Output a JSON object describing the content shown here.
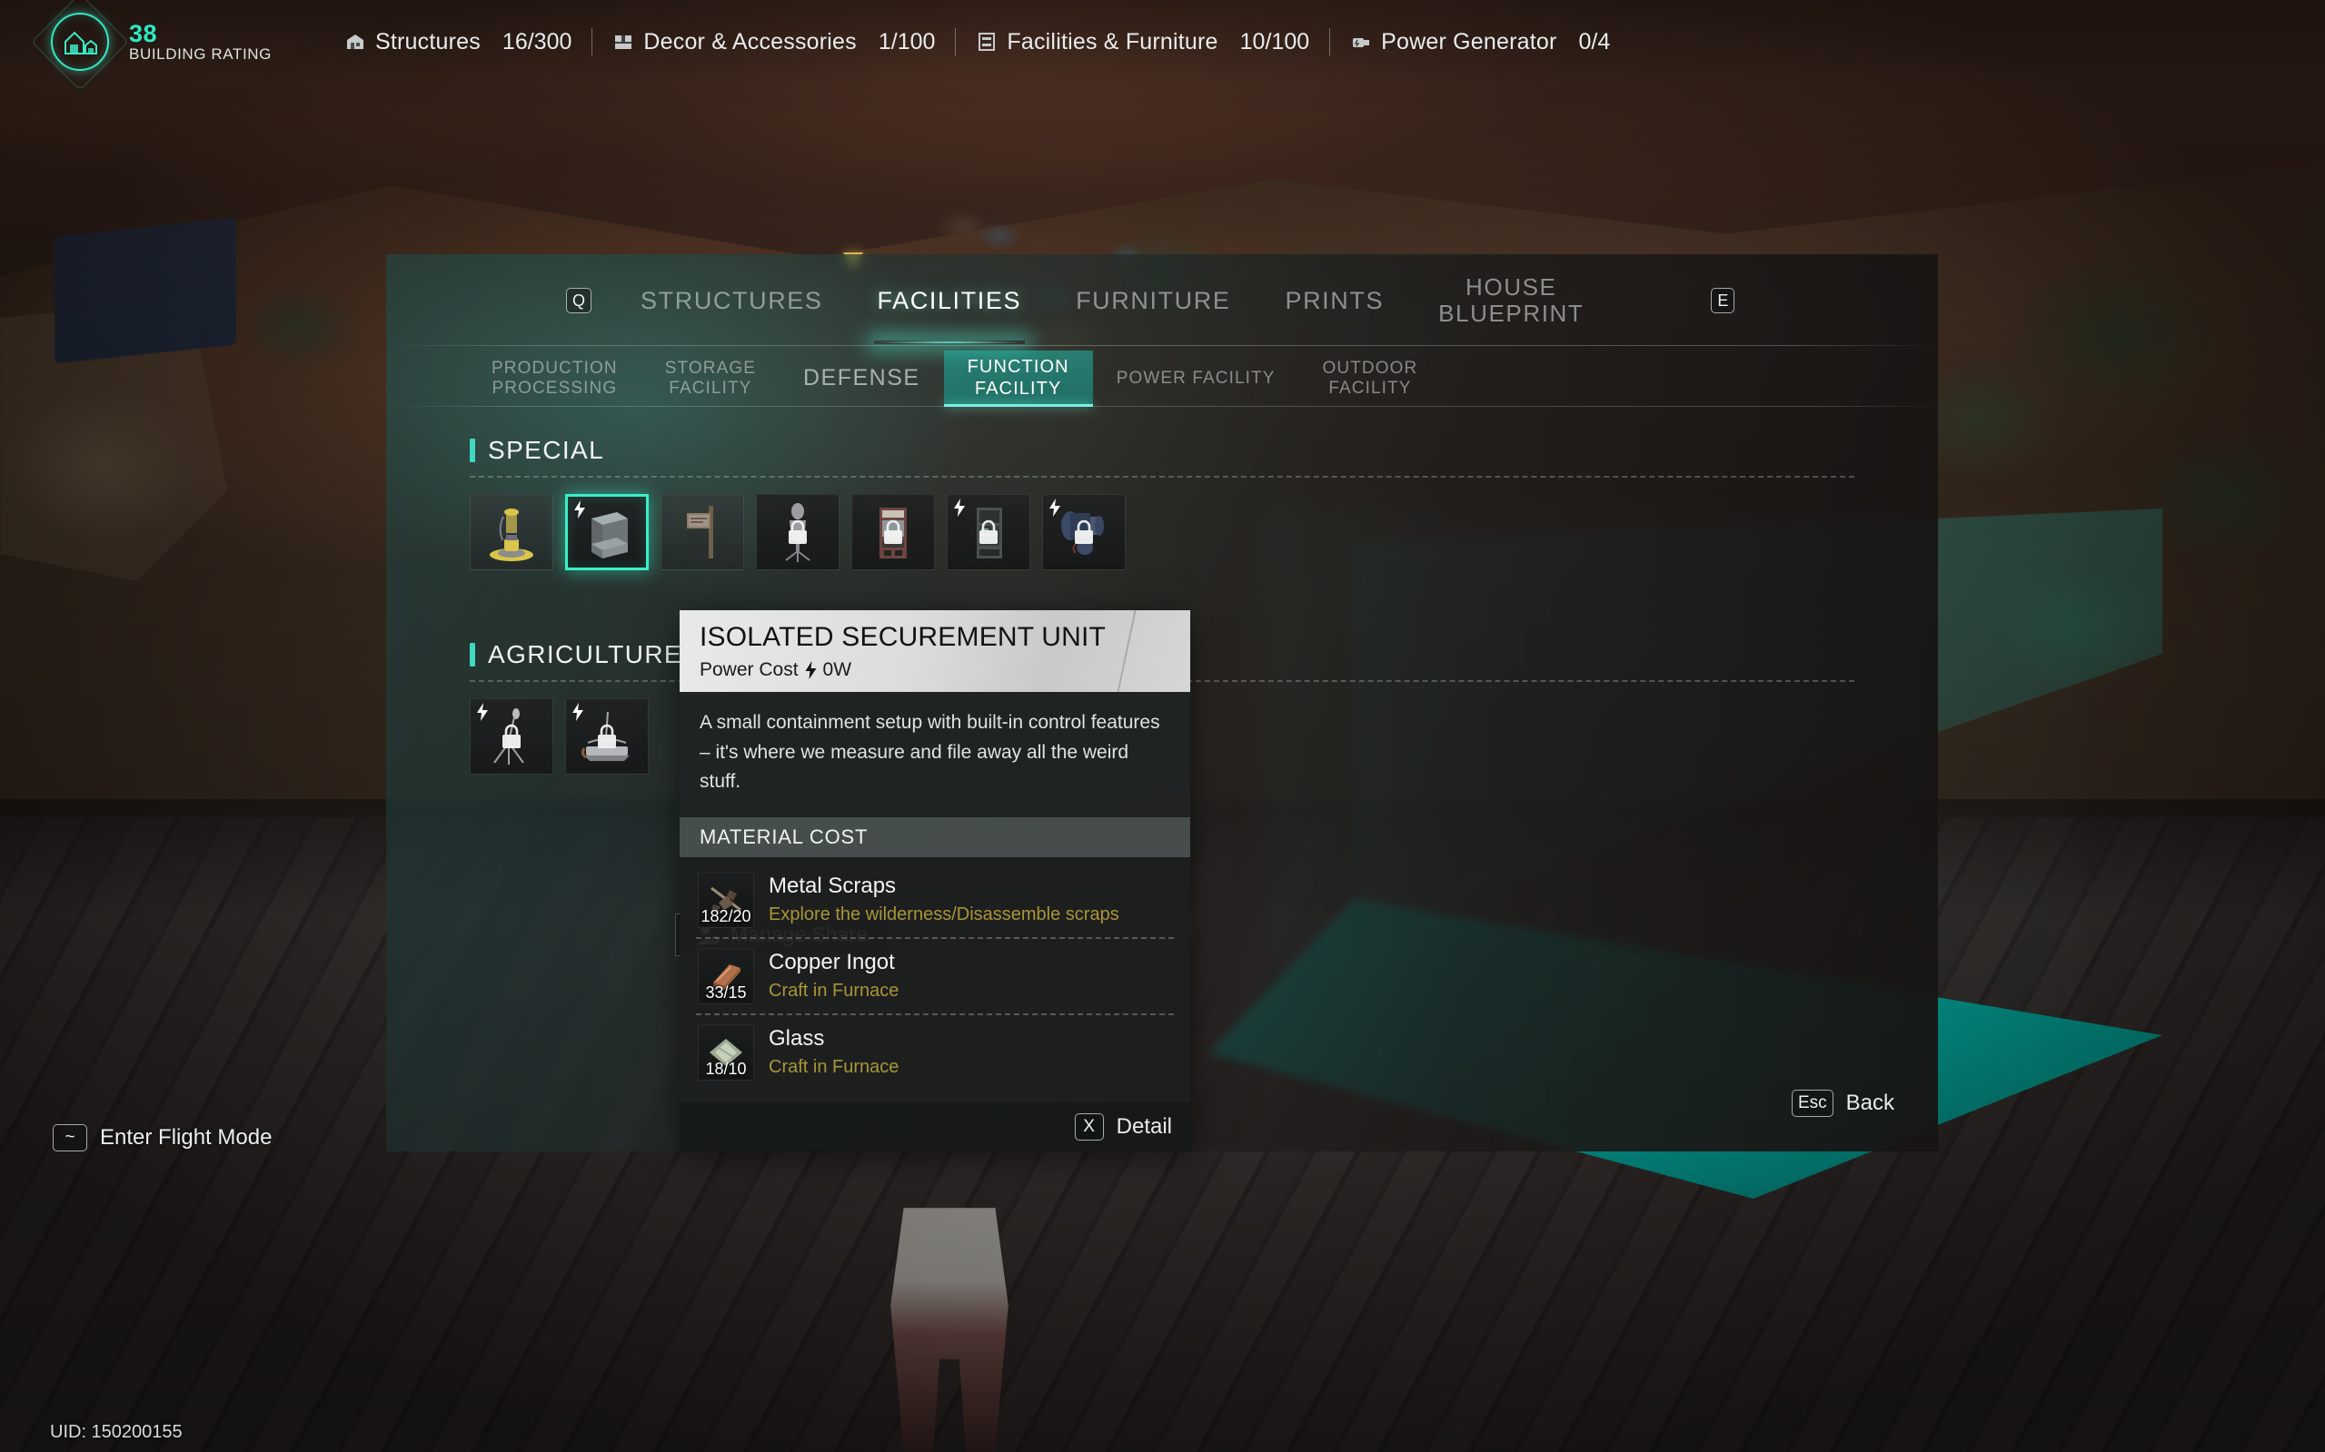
{
  "hud": {
    "rating_value": "38",
    "rating_label": "BUILDING RATING",
    "stats": [
      {
        "icon": "structures-icon",
        "name": "Structures",
        "value": "16/300"
      },
      {
        "icon": "decor-icon",
        "name": "Decor & Accessories",
        "value": "1/100"
      },
      {
        "icon": "facilities-icon",
        "name": "Facilities & Furniture",
        "value": "10/100"
      },
      {
        "icon": "power-generator-icon",
        "name": "Power Generator",
        "value": "0/4"
      }
    ]
  },
  "panel": {
    "left_key": "Q",
    "right_key": "E",
    "tabs": [
      {
        "label": "STRUCTURES",
        "active": false
      },
      {
        "label": "FACILITIES",
        "active": true
      },
      {
        "label": "FURNITURE",
        "active": false
      },
      {
        "label": "PRINTS",
        "active": false
      },
      {
        "label": "HOUSE\nBLUEPRINT",
        "active": false
      }
    ],
    "subtabs": [
      {
        "label": "PRODUCTION\nPROCESSING",
        "active": false
      },
      {
        "label": "STORAGE\nFACILITY",
        "active": false
      },
      {
        "label": "DEFENSE",
        "active": false
      },
      {
        "label": "FUNCTION\nFACILITY",
        "active": true
      },
      {
        "label": "POWER FACILITY",
        "active": false
      },
      {
        "label": "OUTDOOR\nFACILITY",
        "active": false
      }
    ],
    "groups": [
      {
        "title": "SPECIAL",
        "items": [
          {
            "name": "beacon-lamp",
            "selected": false,
            "locked": false,
            "powered": false
          },
          {
            "name": "isolated-securement-unit",
            "selected": true,
            "locked": false,
            "powered": true
          },
          {
            "name": "wall-sign",
            "selected": false,
            "locked": false,
            "powered": false
          },
          {
            "name": "mannequin-stand",
            "selected": false,
            "locked": true,
            "powered": false
          },
          {
            "name": "arcade-cabinet",
            "selected": false,
            "locked": true,
            "powered": false
          },
          {
            "name": "server-rack",
            "selected": false,
            "locked": true,
            "powered": true
          },
          {
            "name": "industrial-motor",
            "selected": false,
            "locked": true,
            "powered": true
          }
        ]
      },
      {
        "title": "AGRICULTURE",
        "items": [
          {
            "name": "sprinkler-tripod",
            "selected": false,
            "locked": true,
            "powered": true
          },
          {
            "name": "grow-bed",
            "selected": false,
            "locked": true,
            "powered": true
          }
        ]
      }
    ],
    "manage_share_label": "Manage Share",
    "back_key": "Esc",
    "back_label": "Back"
  },
  "tooltip": {
    "title": "ISOLATED SECUREMENT UNIT",
    "power_label": "Power Cost",
    "power_value": "0W",
    "description": "A small containment setup with built-in control features – it's where we measure and file away all the weird stuff.",
    "material_cost_label": "MATERIAL COST",
    "materials": [
      {
        "name": "Metal Scraps",
        "source": "Explore the wilderness/Disassemble scraps",
        "count": "182/20",
        "icon": "metal-scraps-icon"
      },
      {
        "name": "Copper Ingot",
        "source": "Craft in Furnace",
        "count": "33/15",
        "icon": "copper-ingot-icon"
      },
      {
        "name": "Glass",
        "source": "Craft in Furnace",
        "count": "18/10",
        "icon": "glass-icon"
      }
    ],
    "detail_key": "X",
    "detail_label": "Detail"
  },
  "world": {
    "flight_key": "~",
    "flight_label": "Enter Flight Mode",
    "uid": "UID: 150200155"
  },
  "colors": {
    "accent": "#3fd8c0",
    "accent_bright": "#6ff5df",
    "rating": "#2fe9c3",
    "material_source": "#a99538",
    "hologram": "#00bcae"
  }
}
